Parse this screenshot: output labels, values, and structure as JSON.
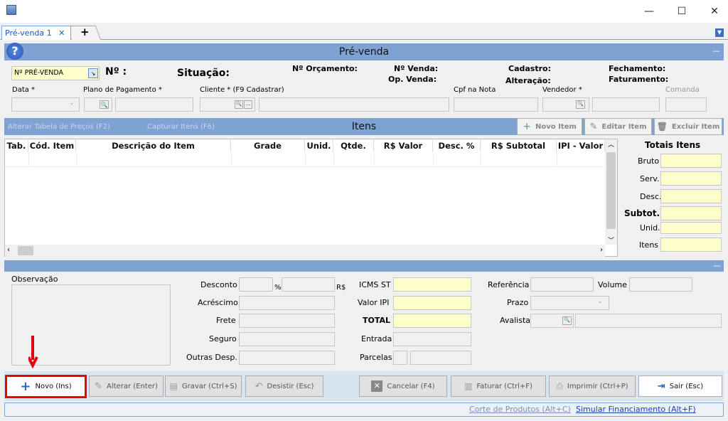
{
  "window": {
    "minimize": "—",
    "maximize": "☐",
    "close": "✕"
  },
  "tabs": [
    {
      "label": "Pré-venda 1",
      "close": "✕"
    },
    {
      "label": "+"
    }
  ],
  "header": {
    "title": "Pré-venda",
    "help": "?",
    "collapse": "—"
  },
  "top": {
    "tipo_value": "Nº PRÉ-VENDA",
    "no_label": "Nº :",
    "situacao_label": "Situação:",
    "orcamento_label": "Nº Orçamento:",
    "venda_label": "Nº Venda:",
    "opvenda_label": "Op. Venda:",
    "cadastro_label": "Cadastro:",
    "alteracao_label": "Alteração:",
    "fechamento_label": "Fechamento:",
    "faturamento_label": "Faturamento:",
    "data_label": "Data *",
    "plano_label": "Plano de Pagamento *",
    "cliente_label": "Cliente * (F9 Cadastrar)",
    "cpf_label": "Cpf na Nota",
    "vendedor_label": "Vendedor *",
    "comanda_label": "Comanda"
  },
  "itens_bar": {
    "alterar_tabela": "Alterar Tabela de Preços (F2)",
    "capturar": "Capturar Itens (F6)",
    "title": "Itens",
    "novo_item": "Novo Item",
    "editar_item": "Editar Item",
    "excluir_item": "Excluir Item"
  },
  "grid": {
    "columns": [
      "Tab.",
      "Cód. Item",
      "Descrição do Item",
      "Grade",
      "Unid.",
      "Qtde.",
      "R$ Valor",
      "Desc. %",
      "R$ Subtotal",
      "IPI - Valor"
    ]
  },
  "totais": {
    "title": "Totais Itens",
    "bruto": "Bruto",
    "serv": "Serv.",
    "desc": "Desc.",
    "subtot": "Subtot.",
    "unid": "Unid.",
    "itens": "Itens"
  },
  "bottom": {
    "observacao": "Observação",
    "desconto": "Desconto",
    "pct": "%",
    "rs": "R$",
    "acrescimo": "Acréscimo",
    "frete": "Frete",
    "seguro": "Seguro",
    "outras": "Outras Desp.",
    "icms": "ICMS ST",
    "ipi": "Valor IPI",
    "total": "TOTAL",
    "entrada": "Entrada",
    "parcelas": "Parcelas",
    "referencia": "Referência",
    "volume": "Volume",
    "prazo": "Prazo",
    "avalista": "Avalista"
  },
  "actions": {
    "novo": "Novo (Ins)",
    "alterar": "Alterar (Enter)",
    "gravar": "Gravar (Ctrl+S)",
    "desistir": "Desistir (Esc)",
    "cancelar": "Cancelar (F4)",
    "faturar": "Faturar (Ctrl+F)",
    "imprimir": "Imprimir (Ctrl+P)",
    "sair": "Sair (Esc)"
  },
  "status": {
    "corte": "Corte de Produtos (Alt+C)",
    "simular": "Simular Financiamento (Alt+F)"
  },
  "colors": {
    "header": "#7ea3d2",
    "highlight": "#e8000b",
    "yellow": "#ffffcc"
  }
}
